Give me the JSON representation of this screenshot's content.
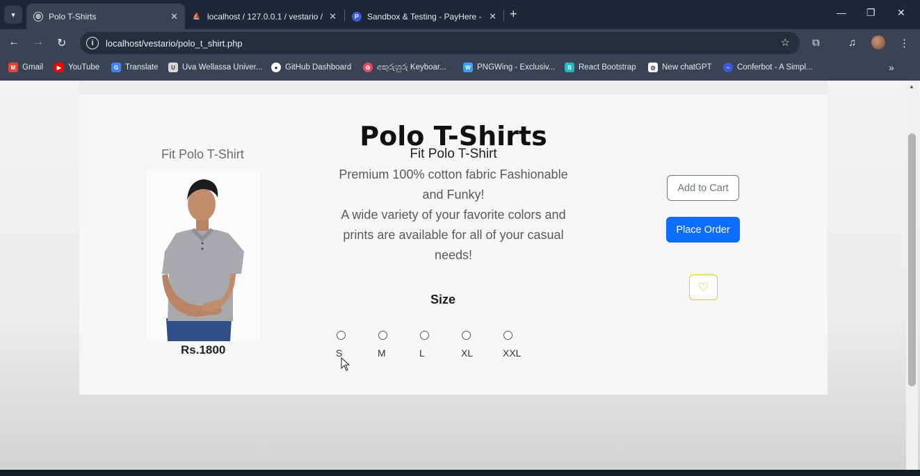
{
  "browser": {
    "tabs": [
      {
        "title": "Polo T-Shirts",
        "active": true,
        "icon": "globe-icon"
      },
      {
        "title": "localhost / 127.0.0.1 / vestario /",
        "active": false,
        "icon": "phpmyadmin-icon"
      },
      {
        "title": "Sandbox & Testing - PayHere -",
        "active": false,
        "icon": "payhere-icon"
      }
    ],
    "new_tab_label": "+",
    "url": "localhost/vestario/polo_t_shirt.php",
    "bookmarks": [
      {
        "label": "Gmail",
        "icon": "gmail-icon",
        "color": "#ea4335"
      },
      {
        "label": "YouTube",
        "icon": "youtube-icon",
        "color": "#ff0000"
      },
      {
        "label": "Translate",
        "icon": "translate-icon",
        "color": "#4285f4"
      },
      {
        "label": "Uva Wellassa Univer...",
        "icon": "university-icon",
        "color": "#8a8a8a"
      },
      {
        "label": "GitHub Dashboard",
        "icon": "github-icon",
        "color": "#222222"
      },
      {
        "label": "අකුරුහුරු Keyboar...",
        "icon": "keyboard-icon",
        "color": "#e84a5f"
      },
      {
        "label": "PNGWing - Exclusiv...",
        "icon": "pngwing-icon",
        "color": "#3aa0ff"
      },
      {
        "label": "React Bootstrap",
        "icon": "react-icon",
        "color": "#1fb8c9"
      },
      {
        "label": "New chatGPT",
        "icon": "chatgpt-icon",
        "color": "#ffffff"
      },
      {
        "label": "Conferbot - A Simpl...",
        "icon": "conferbot-icon",
        "color": "#3b5bdb"
      }
    ]
  },
  "page": {
    "title": "Polo T-Shirts",
    "product": {
      "name_left": "Fit Polo T-Shirt",
      "price": "Rs.1800",
      "desc_title": "Fit Polo T-Shirt",
      "desc_line1": "Premium 100% cotton fabric Fashionable and Funky!",
      "desc_line2": "A wide variety of your favorite colors and prints are available for all of your casual needs!"
    },
    "size": {
      "title": "Size",
      "options": [
        "S",
        "M",
        "L",
        "XL",
        "XXL"
      ]
    },
    "buttons": {
      "add_to_cart": "Add to Cart",
      "place_order": "Place Order"
    }
  },
  "colors": {
    "primary": "#0d6efd",
    "secondary": "#6c757d",
    "warning": "#ffc107"
  }
}
